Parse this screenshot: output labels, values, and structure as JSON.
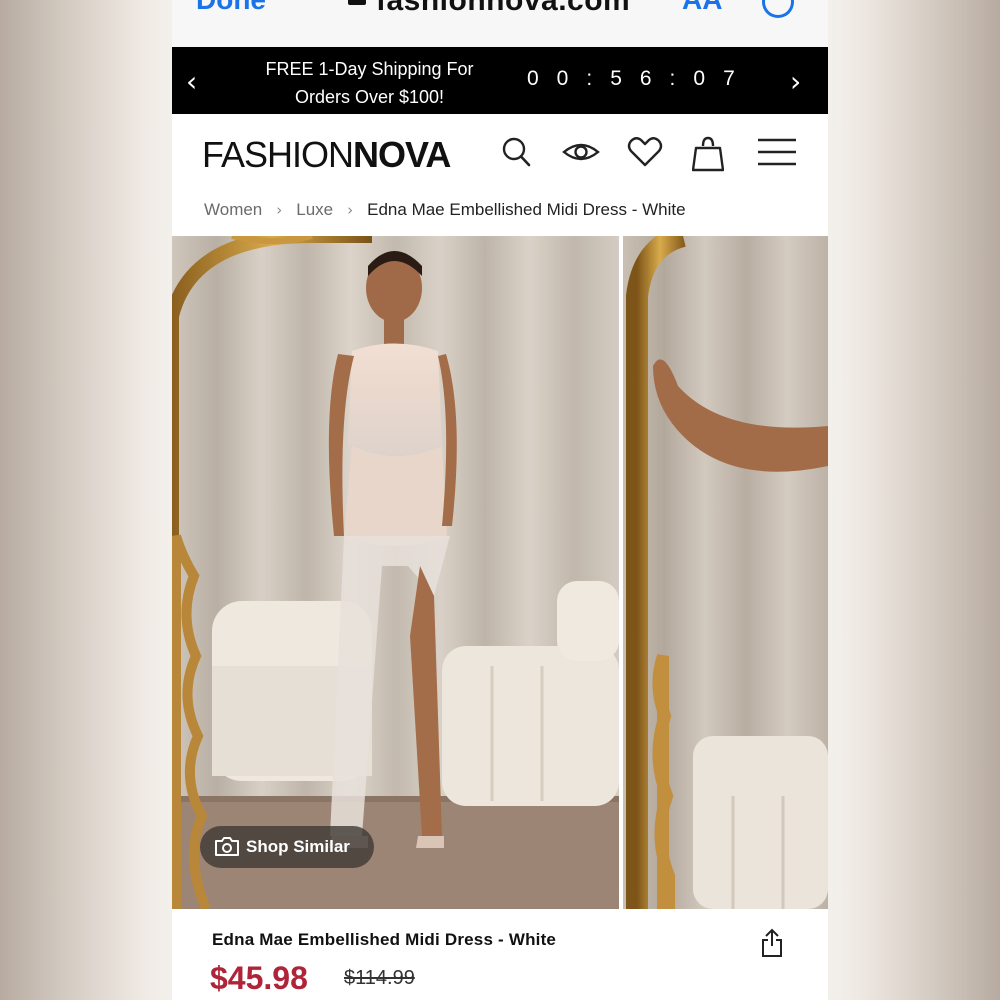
{
  "safari": {
    "done_label": "Done",
    "url": "fashionnova.com",
    "aa_label": "AA"
  },
  "promo": {
    "text_line1": "FREE 1-Day Shipping For",
    "text_line2": "Orders Over $100!",
    "countdown": "00:56:07"
  },
  "header": {
    "logo_light": "FASHION",
    "logo_bold": "NOVA",
    "icons": [
      "search-icon",
      "eye-icon",
      "heart-icon",
      "bag-icon",
      "menu-icon"
    ]
  },
  "breadcrumb": {
    "items": [
      "Women",
      "Luxe",
      "Edna Mae Embellished Midi Dress - White"
    ]
  },
  "gallery": {
    "shop_similar_label": "Shop Similar"
  },
  "product": {
    "title": "Edna Mae Embellished Midi Dress - White",
    "price": "$45.98",
    "original_price": "$114.99"
  },
  "colors": {
    "promo_bg": "#000000",
    "price": "#b0243a",
    "link_blue": "#1a73e8"
  }
}
